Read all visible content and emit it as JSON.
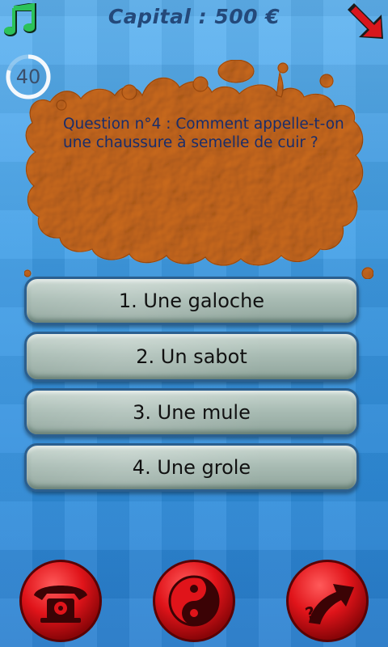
{
  "header": {
    "capital_text": "Capital : 500 €",
    "music_icon": "music-note-icon",
    "exit_icon": "exit-arrow-icon"
  },
  "timer": {
    "value": "40",
    "remaining_fraction": 0.8
  },
  "question": {
    "text": "Question n°4 : Comment appelle-t-on une chaussure à semelle de cuir ?"
  },
  "answers": [
    {
      "label": "1. Une galoche"
    },
    {
      "label": "2. Un sabot"
    },
    {
      "label": "3. Une mule"
    },
    {
      "label": "4. Une grole"
    }
  ],
  "jokers": [
    {
      "name": "phone-a-friend",
      "icon": "telephone-icon"
    },
    {
      "name": "fifty-fifty",
      "icon": "yin-yang-icon"
    },
    {
      "name": "skip-question",
      "icon": "question-arrow-icon"
    }
  ],
  "colors": {
    "capital_text": "#24497a",
    "question_blob": "#e0a45e",
    "answer_button": "#a9bcb4",
    "joker_red": "#e0141a",
    "music_green": "#1fae4a"
  }
}
